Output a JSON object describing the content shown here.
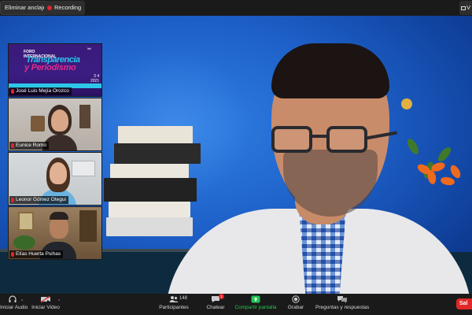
{
  "topbar": {
    "unpin_label": "Eliminar anclaje",
    "recording_label": "Recording",
    "view_label": "V"
  },
  "thumbnails": [
    {
      "name": "José Luis Mejía Orozco",
      "type": "poster"
    },
    {
      "name": "Eunice Romo",
      "type": "video"
    },
    {
      "name": "Leonor Gómez Otegui",
      "type": "video"
    },
    {
      "name": "Elías Huerta Psihas",
      "type": "video"
    }
  ],
  "poster": {
    "foro_line1": "FORO",
    "foro_line2": "INTERNACIONAL",
    "title_line1": "Transparencia",
    "title_line2": "y Periodismo",
    "date_line1": "3  4",
    "date_line2": "2021",
    "logo": "itei"
  },
  "toolbar": {
    "audio_label": "Iniciar Audio",
    "video_label": "Iniciar Video",
    "participants_count": "148",
    "participants_label": "Participantes",
    "chat_label": "Chatear",
    "chat_badge": "1",
    "share_label": "Compartir pantalla",
    "record_label": "Grabar",
    "qa_label": "Preguntas y respuestas",
    "end_label": "Sal",
    "share_color": "#23c552"
  },
  "colors": {
    "recording_dot": "#e0252b",
    "end_button": "#e02828",
    "poster_cyan": "#2cc6e8",
    "poster_magenta": "#e32c8a"
  }
}
